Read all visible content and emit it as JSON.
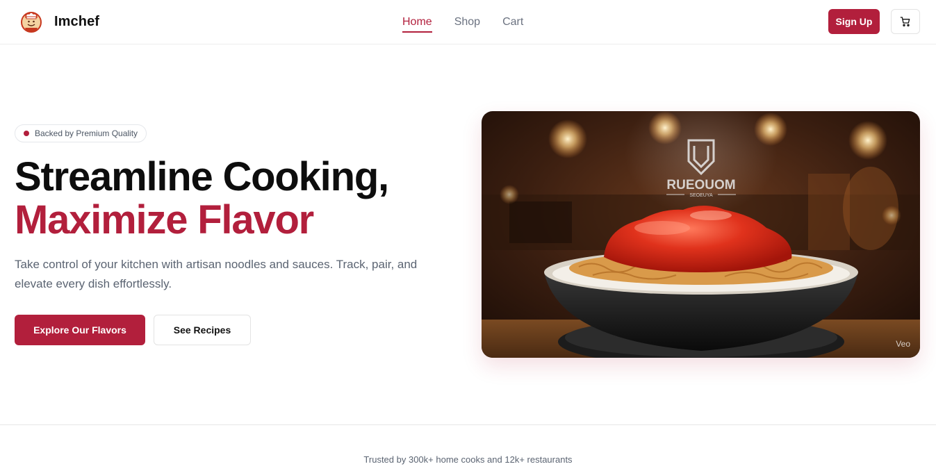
{
  "header": {
    "brand_name": "Imchef",
    "nav": [
      {
        "label": "Home",
        "active": true
      },
      {
        "label": "Shop",
        "active": false
      },
      {
        "label": "Cart",
        "active": false
      }
    ],
    "signup_label": "Sign Up",
    "cart_icon": "cart-icon"
  },
  "hero": {
    "badge": "Backed by Premium Quality",
    "headline_line1": "Streamline Cooking,",
    "headline_line2": "Maximize Flavor",
    "subtext": "Take control of your kitchen with artisan noodles and sauces. Track, pair, and elevate every dish effortlessly.",
    "primary_cta": "Explore Our Flavors",
    "secondary_cta": "See Recipes",
    "image_watermark": "Veo"
  },
  "trust": {
    "text": "Trusted by 300k+ home cooks and 12k+ restaurants"
  },
  "colors": {
    "accent": "#b21f3c",
    "muted_text": "#5b6472",
    "nav_text": "#6b7280"
  }
}
